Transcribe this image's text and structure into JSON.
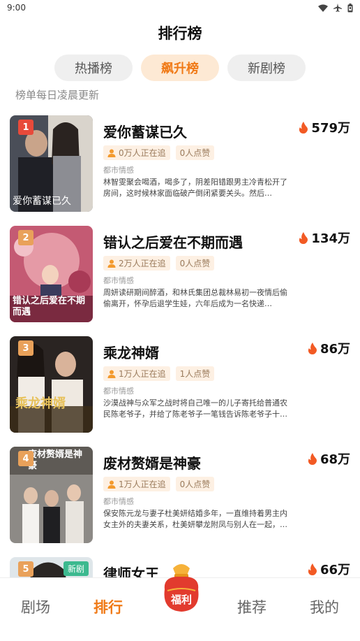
{
  "status": {
    "time": "9:00"
  },
  "header": {
    "title": "排行榜"
  },
  "tabs": [
    {
      "label": "热播榜",
      "active": false
    },
    {
      "label": "飙升榜",
      "active": true
    },
    {
      "label": "新剧榜",
      "active": false
    }
  ],
  "subtitle": "榜单每日凌晨更新",
  "items": [
    {
      "rank": "1",
      "title": "爱你蓄谋已久",
      "heat": "579万",
      "followers": "0万人正在追",
      "likes": "0人点赞",
      "genre": "都市情感",
      "desc": "林智雯聚会喝酒，喝多了，阴差阳错跟男主冷青松开了房间，这时候林家面临破产倒闭紧要关头。然后…",
      "cover_text": "爱你蓄谋已久"
    },
    {
      "rank": "2",
      "title": "错认之后爱在不期而遇",
      "heat": "134万",
      "followers": "2万人正在追",
      "likes": "0人点赞",
      "genre": "都市情感",
      "desc": "周妍读研期间醉酒，和林氏集团总裁林易初一夜情后偷偷离开，怀孕后退学生娃，六年后成为一名快递…",
      "cover_text": "错认之后爱在不期而遇"
    },
    {
      "rank": "3",
      "title": "乘龙神婿",
      "heat": "86万",
      "followers": "1万人正在追",
      "likes": "1人点赞",
      "genre": "都市情感",
      "desc": "沙漠战神与众军之战时将自己唯一的儿子寄托给普通农民陈老爷子，并给了陈老爷子一笔钱告诉陈老爷子十…",
      "cover_text": "乘龙神婿"
    },
    {
      "rank": "4",
      "title": "废材赘婿是神豪",
      "heat": "68万",
      "followers": "1万人正在追",
      "likes": "0人点赞",
      "genre": "都市情感",
      "desc": "保安陈元龙与妻子杜美妍结婚多年，一直维持着男主内女主外的夫妻关系，杜美妍攀龙附凤与别人在一起，…",
      "cover_text": "废材赘婿是神豪"
    },
    {
      "rank": "5",
      "title": "律师女王",
      "heat": "66万",
      "badge": "新剧"
    }
  ],
  "nav": {
    "theater": "剧场",
    "ranking": "排行",
    "welfare": "福利",
    "recommend": "推荐",
    "mine": "我的"
  },
  "colors": {
    "accent": "#f07a17",
    "tab_active_bg": "#fde9d4",
    "rank1": "#e84a3a",
    "rank_other": "#e9a15a",
    "new_badge": "#3cb98f"
  },
  "icons": {
    "wifi": "wifi-icon",
    "airplane": "airplane-icon",
    "battery": "battery-icon",
    "fire": "fire-icon",
    "person": "person-icon",
    "bag": "lucky-bag-icon"
  }
}
